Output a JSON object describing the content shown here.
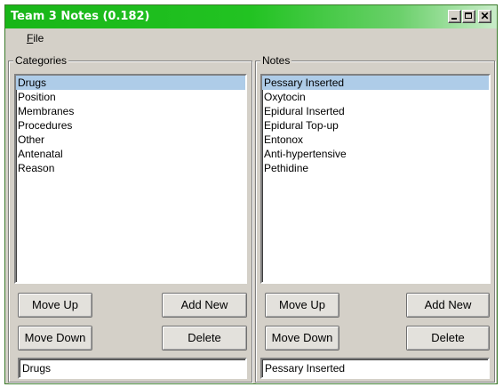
{
  "window": {
    "title": "Team 3 Notes (0.182)",
    "minimize_icon": "minimize-icon",
    "maximize_icon": "maximize-icon",
    "close_icon": "close-icon",
    "close_glyph": "✕"
  },
  "menu": {
    "file": "File"
  },
  "categories": {
    "legend": "Categories",
    "items": [
      "Drugs",
      "Position",
      "Membranes",
      "Procedures",
      "Other",
      "Antenatal",
      "Reason"
    ],
    "selected_index": 0,
    "buttons": {
      "move_up": "Move Up",
      "add_new": "Add New",
      "move_down": "Move Down",
      "delete": "Delete"
    },
    "input_value": "Drugs"
  },
  "notes": {
    "legend": "Notes",
    "items": [
      "Pessary Inserted",
      "Oxytocin",
      "Epidural Inserted",
      "Epidural Top-up",
      "Entonox",
      "Anti-hypertensive",
      "Pethidine"
    ],
    "selected_index": 0,
    "buttons": {
      "move_up": "Move Up",
      "add_new": "Add New",
      "move_down": "Move Down",
      "delete": "Delete"
    },
    "input_value": "Pessary Inserted"
  },
  "colors": {
    "title_bar": "#18b618",
    "selection": "#aecce8",
    "window_face": "#d4d0c8"
  }
}
